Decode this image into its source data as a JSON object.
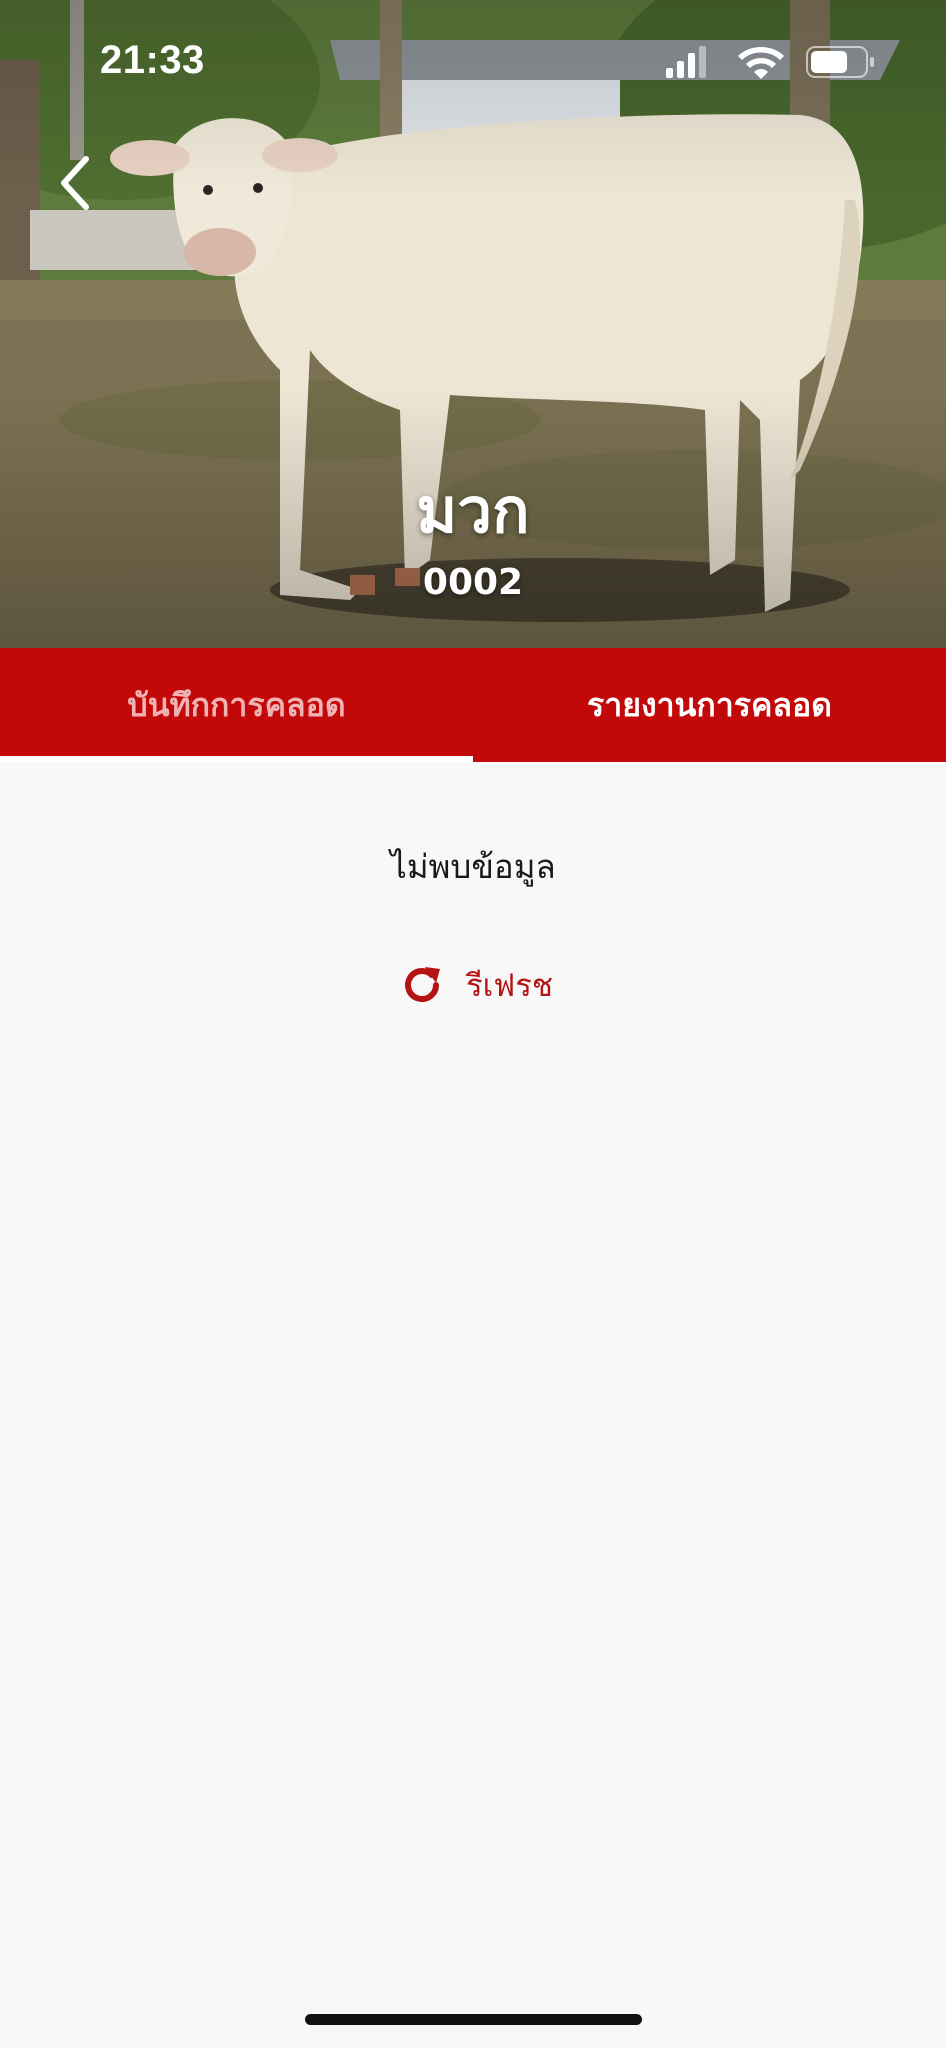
{
  "status_bar": {
    "time": "21:33",
    "signal_icon": "cellular-signal-icon",
    "wifi_icon": "wifi-icon",
    "battery_icon": "battery-icon"
  },
  "header": {
    "back_icon": "chevron-left-icon",
    "image_subject": "white-cow-photo",
    "animal_name": "มวก",
    "animal_id": "0002"
  },
  "tabs": [
    {
      "label": "บันทึกการคลอด",
      "active": false
    },
    {
      "label": "รายงานการคลอด",
      "active": true
    }
  ],
  "content": {
    "empty_message": "ไม่พบข้อมูล",
    "refresh_icon": "refresh-icon",
    "refresh_label": "รีเฟรช"
  },
  "colors": {
    "brand_red": "#c20808",
    "refresh_red": "#b51414",
    "tab_inactive_text": "#f0b3b3",
    "background": "#f8f8f8"
  }
}
